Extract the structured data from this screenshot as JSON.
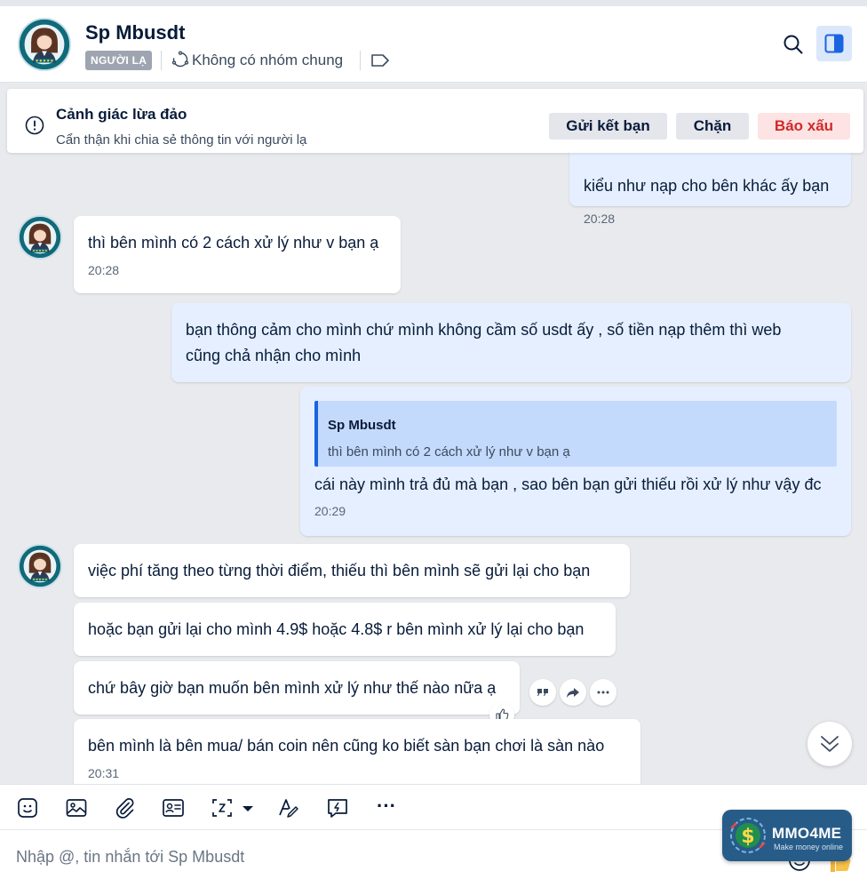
{
  "header": {
    "name": "Sp Mbusdt",
    "badge": "NGƯỜI LẠ",
    "groups": "Không có nhóm chung"
  },
  "warning": {
    "title": "Cảnh giác lừa đảo",
    "subtitle": "Cẩn thận khi chia sẻ thông tin với người lạ",
    "add_friend": "Gửi kết bạn",
    "block": "Chặn",
    "report": "Báo xấu"
  },
  "messages": {
    "m0": {
      "text": "kiểu như nạp cho bên khác ấy bạn",
      "time": "20:28"
    },
    "m1": {
      "text": "thì bên mình có 2 cách xử lý như v bạn ạ",
      "time": "20:28"
    },
    "m2": {
      "line1": "bạn thông cảm cho mình chứ mình không cầm số usdt ấy , số tiền nạp thêm thì web",
      "line2": "cũng chả nhận cho mình"
    },
    "m3": {
      "quote_name": "Sp Mbusdt",
      "quote_text": "thì bên mình có 2 cách xử lý như v bạn ạ",
      "text": "cái này mình trả đủ mà bạn , sao bên bạn gửi thiếu rồi xử lý như vậy đc",
      "time": "20:29"
    },
    "m4": {
      "text": "việc phí tăng theo từng thời điểm, thiếu thì bên mình sẽ gửi lại cho bạn"
    },
    "m5": {
      "text": "hoặc bạn gửi lại cho mình 4.9$ hoặc 4.8$ r bên mình xử lý lại cho bạn"
    },
    "m6": {
      "text": "chứ bây giờ bạn muốn bên mình xử lý như thế nào nữa ạ"
    },
    "m7": {
      "text": "bên mình là bên mua/ bán coin nên cũng ko biết sàn bạn chơi là sàn nào",
      "time": "20:31"
    }
  },
  "composer": {
    "placeholder": "Nhập @, tin nhắn tới Sp Mbusdt",
    "more": "···"
  },
  "watermark": {
    "title": "MMO4ME",
    "subtitle": "Make money online"
  },
  "colors": {
    "accent": "#1a64e0",
    "incoming_bubble": "#ffffff",
    "outgoing_bubble": "#e5efff",
    "report": "#d12a2a"
  }
}
